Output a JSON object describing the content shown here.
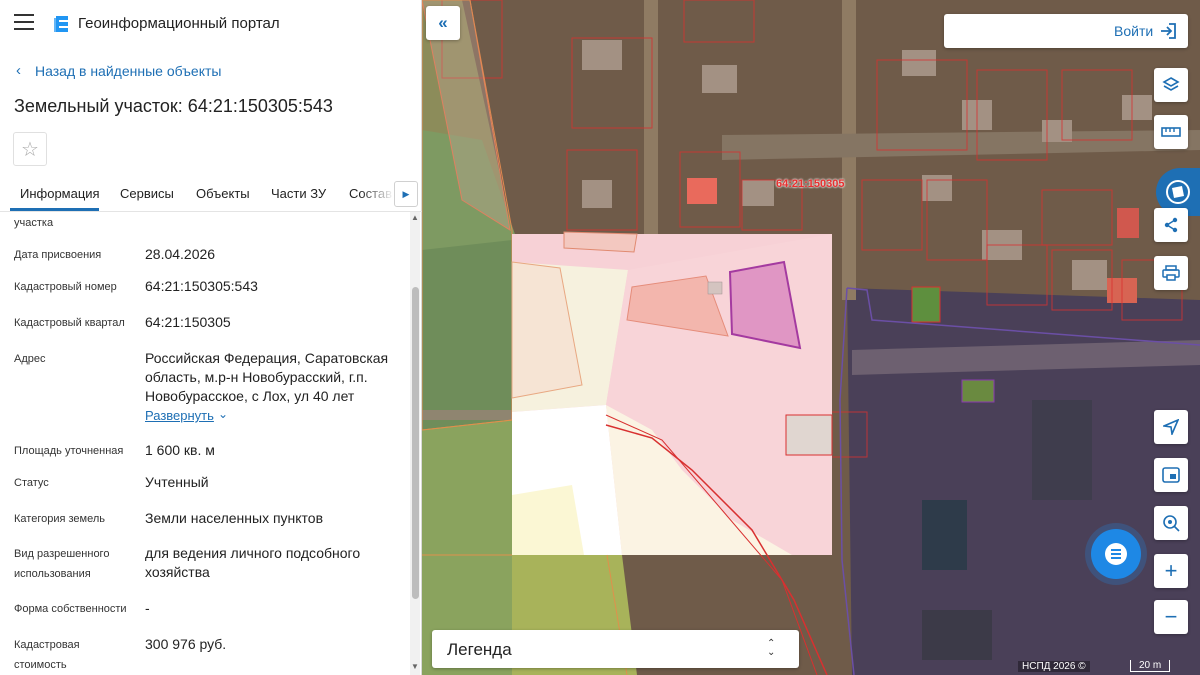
{
  "header": {
    "portal_title": "Геоинформационный портал"
  },
  "nav": {
    "back_label": "Назад в найденные объекты"
  },
  "parcel": {
    "title": "Земельный участок: 64:21:150305:543"
  },
  "tabs": [
    {
      "label": "Информация",
      "active": true
    },
    {
      "label": "Сервисы"
    },
    {
      "label": "Объекты"
    },
    {
      "label": "Части ЗУ"
    },
    {
      "label": "Состав"
    }
  ],
  "info": {
    "cut_label": "участка",
    "rows": [
      {
        "label": "Дата присвоения",
        "value": "28.04.2026"
      },
      {
        "label": "Кадастровый номер",
        "value": "64:21:150305:543"
      },
      {
        "label": "Кадастровый квартал",
        "value": "64:21:150305"
      },
      {
        "label": "Адрес",
        "value": "Российская Федерация, Саратовская область, м.р-н Новобурасский, г.п. Новобурасское, с Лох, ул 40 лет"
      },
      {
        "label": "Площадь уточненная",
        "value": "1 600 кв. м"
      },
      {
        "label": "Статус",
        "value": "Учтенный"
      },
      {
        "label": "Категория земель",
        "value": "Земли населенных пунктов"
      },
      {
        "label": "Вид разрешенного использования",
        "value": "для ведения личного подсобного хозяйства"
      },
      {
        "label": "Форма собственности",
        "value": "-"
      },
      {
        "label": "Кадастровая стоимость",
        "value": "300 976 руб."
      }
    ],
    "expand_label": "Развернуть"
  },
  "map": {
    "login_label": "Войти",
    "parcel_label": "64:21:150305",
    "legend_label": "Легенда",
    "copyright": "НСПД 2026 ©",
    "scale": "20 m",
    "selection_color": "#c2389e",
    "parcel_border_color": "#d83030",
    "accent": "#1e6fb4"
  }
}
